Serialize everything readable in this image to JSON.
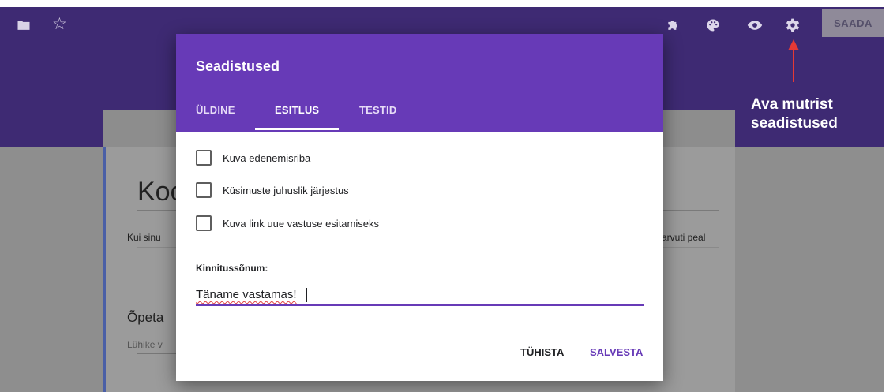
{
  "toolbar": {
    "send_label": "SAADA",
    "icons": [
      "folder-icon",
      "star-icon",
      "puzzle-icon",
      "palette-icon",
      "eye-icon",
      "gear-icon"
    ]
  },
  "form": {
    "title": "Koo",
    "description_left": "Kui sinu",
    "description_right": "arvuti peal",
    "question_title": "Õpeta",
    "answer_placeholder": "Lühike v"
  },
  "dialog": {
    "title": "Seadistused",
    "tabs": [
      {
        "label": "ÜLDINE",
        "active": false
      },
      {
        "label": "ESITLUS",
        "active": true
      },
      {
        "label": "TESTID",
        "active": false
      }
    ],
    "checkboxes": [
      {
        "label": "Kuva edenemisriba",
        "checked": false
      },
      {
        "label": "Küsimuste juhuslik järjestus",
        "checked": false
      },
      {
        "label": "Kuva link uue vastuse esitamiseks",
        "checked": false
      }
    ],
    "confirmation_label": "Kinnitussõnum:",
    "confirmation_value": "Täname vastamas!",
    "cancel_label": "TÜHISTA",
    "save_label": "SALVESTA"
  },
  "annotation": {
    "text_line1": "Ava mutrist",
    "text_line2": "seadistused"
  },
  "colors": {
    "header_purple": "#673ab7",
    "topbar_dimmed": "#3e2a73",
    "arrow_red": "#e53935"
  }
}
